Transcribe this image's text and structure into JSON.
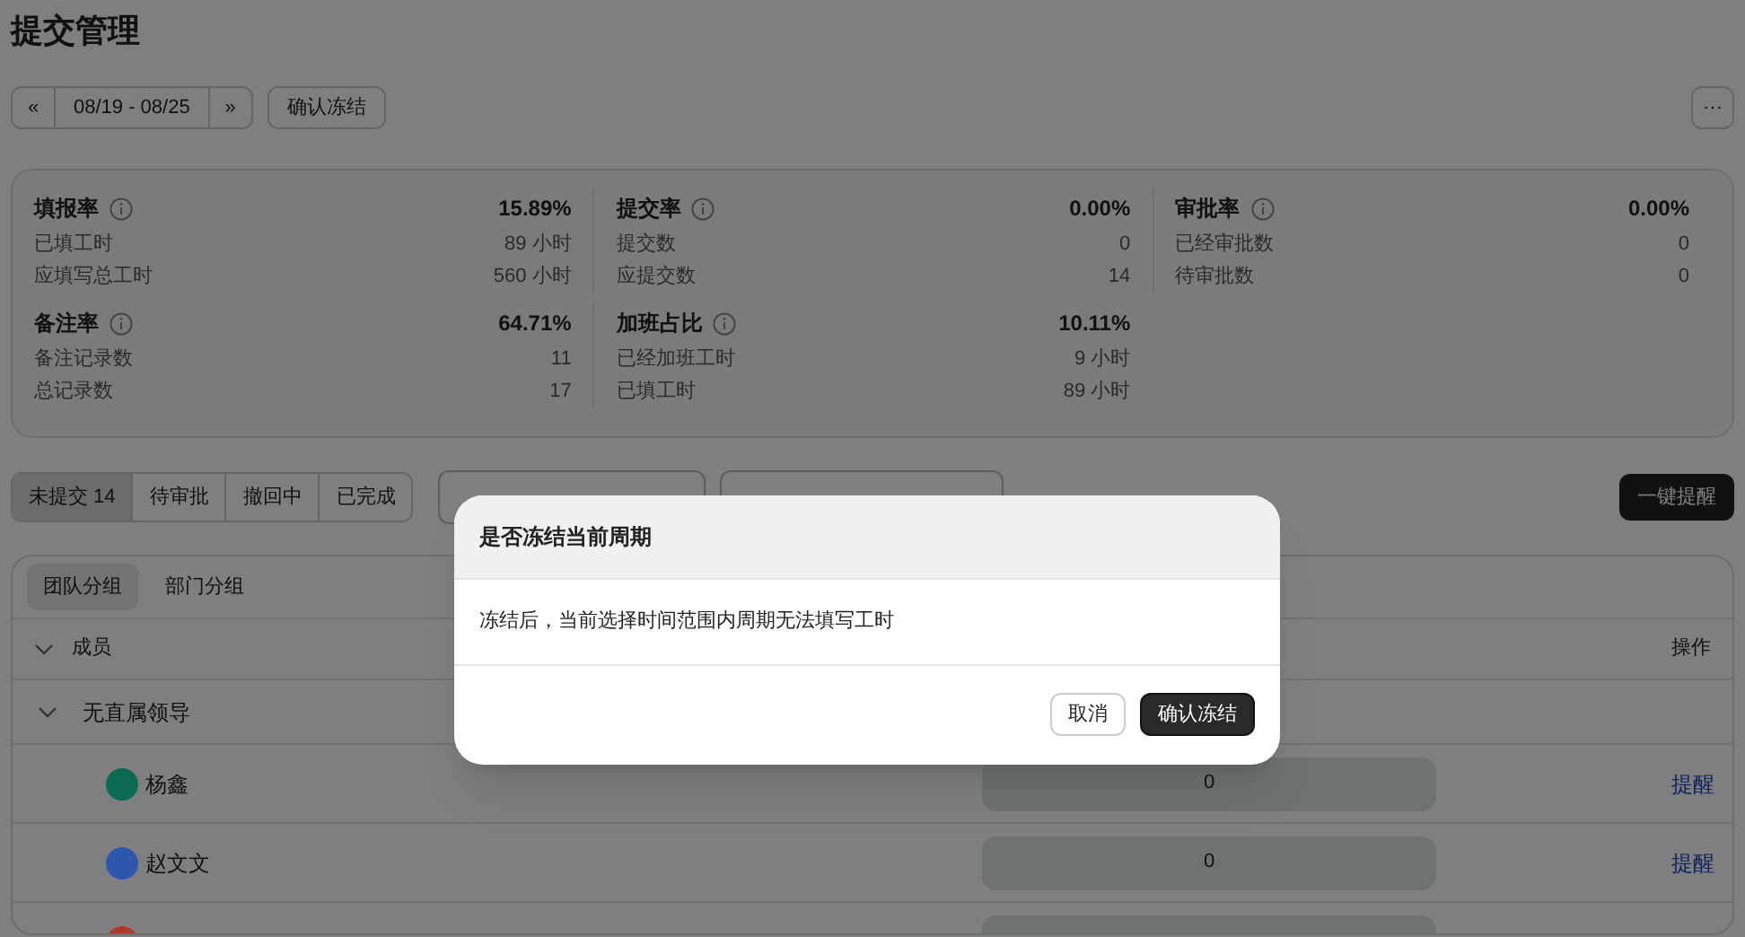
{
  "page_title": "提交管理",
  "toolbar": {
    "prev": "«",
    "range": "08/19 - 08/25",
    "next": "»",
    "freeze_button": "确认冻结",
    "more": "···"
  },
  "stats": [
    {
      "title": "填报率",
      "rate": "15.89%",
      "lines": [
        {
          "label": "已填工时",
          "value": "89 小时"
        },
        {
          "label": "应填写总工时",
          "value": "560 小时"
        }
      ]
    },
    {
      "title": "提交率",
      "rate": "0.00%",
      "lines": [
        {
          "label": "提交数",
          "value": "0"
        },
        {
          "label": "应提交数",
          "value": "14"
        }
      ]
    },
    {
      "title": "审批率",
      "rate": "0.00%",
      "lines": [
        {
          "label": "已经审批数",
          "value": "0"
        },
        {
          "label": "待审批数",
          "value": "0"
        }
      ]
    },
    {
      "title": "备注率",
      "rate": "64.71%",
      "lines": [
        {
          "label": "备注记录数",
          "value": "11"
        },
        {
          "label": "总记录数",
          "value": "17"
        }
      ]
    },
    {
      "title": "加班占比",
      "rate": "10.11%",
      "lines": [
        {
          "label": "已经加班工时",
          "value": "9 小时"
        },
        {
          "label": "已填工时",
          "value": "89 小时"
        }
      ]
    }
  ],
  "status_tabs": [
    {
      "label": "未提交 14",
      "selected": true
    },
    {
      "label": "待审批",
      "selected": false
    },
    {
      "label": "撤回中",
      "selected": false
    },
    {
      "label": "已完成",
      "selected": false
    }
  ],
  "remind_all_button": "一键提醒",
  "group_tabs": [
    {
      "label": "团队分组",
      "selected": true
    },
    {
      "label": "部门分组",
      "selected": false
    }
  ],
  "table": {
    "columns": [
      "成员",
      "操作"
    ],
    "group": {
      "label": "无直属领导",
      "expanded": true
    },
    "rows": [
      {
        "name": "杨鑫",
        "color": "#0b6b52",
        "value": "0",
        "action": "提醒"
      },
      {
        "name": "赵文文",
        "color": "#2d57ae",
        "value": "0",
        "action": "提醒"
      },
      {
        "color": "#b03a2e"
      }
    ]
  },
  "dialog": {
    "title": "是否冻结当前周期",
    "message": "冻结后，当前选择时间范围内周期无法填写工时",
    "buttons": [
      {
        "label": "取消",
        "kind": "secondary"
      },
      {
        "label": "确认冻结",
        "kind": "primary"
      }
    ]
  }
}
